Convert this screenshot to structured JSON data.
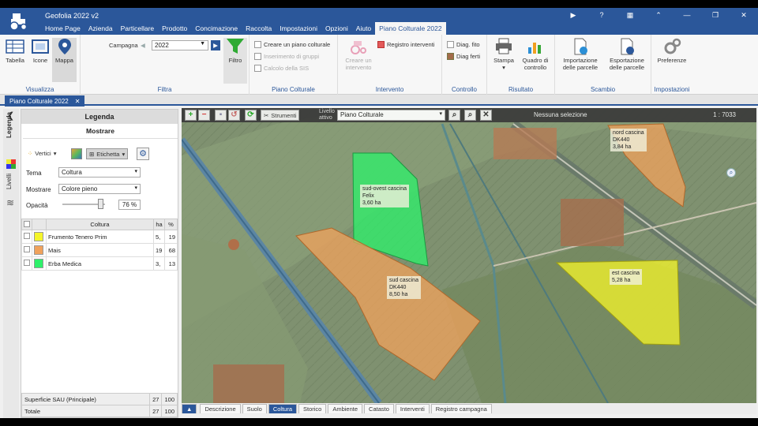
{
  "app": {
    "title": "Geofolia 2022 v2"
  },
  "menu": [
    "Home Page",
    "Azienda",
    "Particellare",
    "Prodotto",
    "Concimazione",
    "Raccolta",
    "Impostazioni",
    "Opzioni",
    "Aiuto",
    "Piano Colturale 2022"
  ],
  "ribbon": {
    "visualizza": {
      "label": "Visualizza",
      "tabella": "Tabella",
      "icone": "Icone",
      "mappa": "Mappa"
    },
    "filtra": {
      "label": "Filtra",
      "campagna_label": "Campagna",
      "campagna_value": "2022",
      "filtro": "Filtro"
    },
    "piano": {
      "label": "Piano Colturale",
      "crea": "Creare un piano colturale",
      "inserimento": "Inserimento di gruppi",
      "calcolo": "Calcolo della SIS"
    },
    "intervento": {
      "label": "Intervento",
      "registro": "Registro interventi",
      "crea_intervento": "Creare un intervento"
    },
    "controllo": {
      "label": "Controllo",
      "diag_fito": "Diag. fito",
      "diag_ferti": "Diag ferti"
    },
    "risultato": {
      "label": "Risultato",
      "stampa": "Stampa",
      "quadro": "Quadro di controllo"
    },
    "scambio": {
      "label": "Scambio",
      "importazione": "Importazione delle parcelle",
      "esportazione": "Esportazione delle parcelle"
    },
    "impostazioni": {
      "label": "Impostazioni",
      "preferenze": "Preferenze"
    }
  },
  "doc_tab": {
    "label": "Piano Colturale 2022"
  },
  "side_tabs": [
    "Legenda",
    "Livelli"
  ],
  "legend": {
    "title": "Legenda",
    "mostrare_title": "Mostrare",
    "vertici": "Vertici",
    "etichetta": "Etichetta",
    "tema_label": "Tema",
    "tema_value": "Coltura",
    "mostrare_label": "Mostrare",
    "mostrare_value": "Colore pieno",
    "opacita_label": "Opacità",
    "opacita_value": "76 %",
    "opacity": 0.76,
    "columns": [
      "Coltura",
      "ha",
      "%"
    ],
    "rows": [
      {
        "name": "Frumento Tenero Prim",
        "ha": "5,",
        "pct": "19",
        "color": "#f5f52a"
      },
      {
        "name": "Mais",
        "ha": "19",
        "pct": "68",
        "color": "#f0a25c"
      },
      {
        "name": "Erba Medica",
        "ha": "3,",
        "pct": "13",
        "color": "#2ef06a"
      }
    ],
    "footer": [
      {
        "label": "Superficie SAU (Principale)",
        "ha": "27",
        "pct": "100"
      },
      {
        "label": "Totale",
        "ha": "27",
        "pct": "100"
      }
    ]
  },
  "map": {
    "strumenti": "Strumenti",
    "livello_label": "Livello attivo",
    "livello_value": "Piano Colturale",
    "selection": "Nessuna selezione",
    "scale": "1 : 7033",
    "parcels": [
      {
        "name": "sud-ovest cascina",
        "line2": "Felix",
        "area": "3,60 ha"
      },
      {
        "name": "nord cascina",
        "line2": "DK440",
        "area": "3,84 ha"
      },
      {
        "name": "sud cascina",
        "line2": "DK440",
        "area": "8,50 ha"
      },
      {
        "name": "est cascina",
        "line2": "",
        "area": "5,28 ha"
      }
    ]
  },
  "bottom_tabs": [
    "Descrizione",
    "Suolo",
    "Coltura",
    "Storico",
    "Ambiente",
    "Catasto",
    "Interventi",
    "Registro campagna"
  ]
}
